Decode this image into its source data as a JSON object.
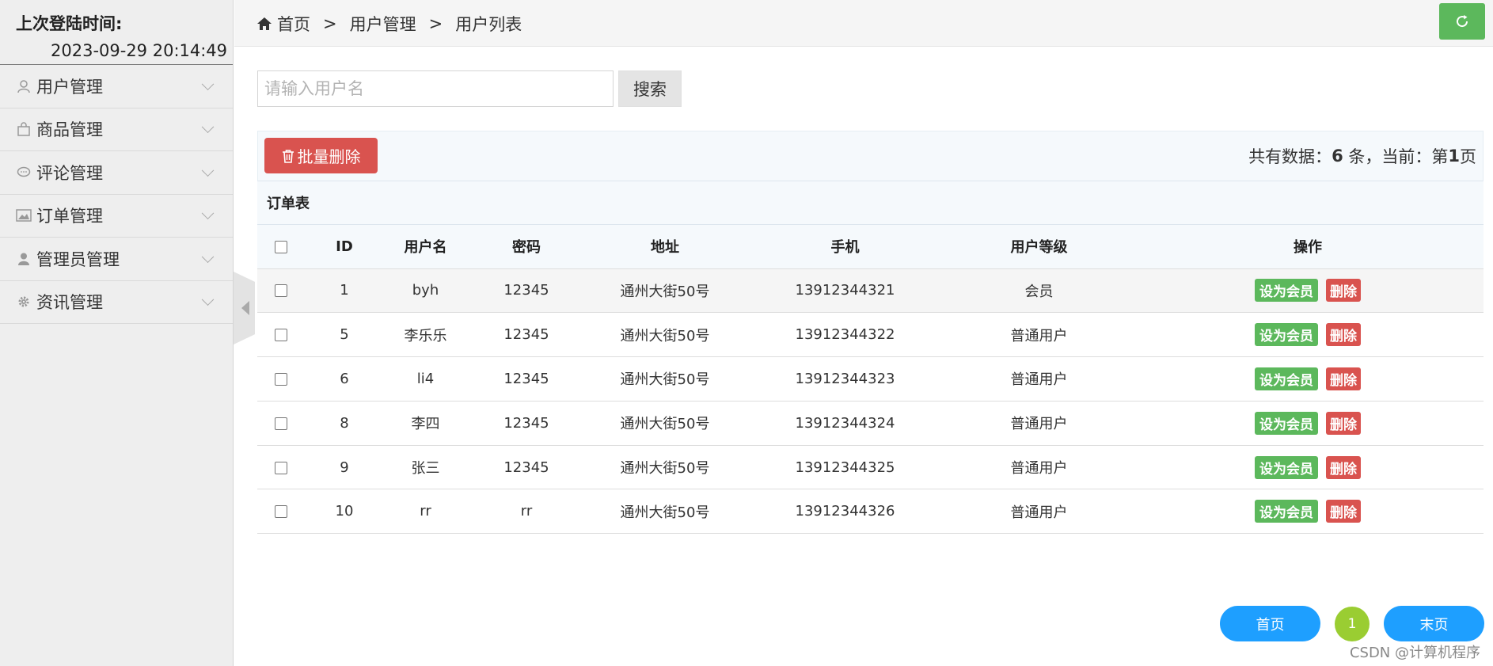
{
  "sidebar": {
    "login_title": "上次登陆时间:",
    "login_time": "2023-09-29 20:14:49",
    "items": [
      {
        "label": "用户管理",
        "icon": "user-icon"
      },
      {
        "label": "商品管理",
        "icon": "shopping-bag-icon"
      },
      {
        "label": "评论管理",
        "icon": "comment-icon"
      },
      {
        "label": "订单管理",
        "icon": "image-icon"
      },
      {
        "label": "管理员管理",
        "icon": "admin-icon"
      },
      {
        "label": "资讯管理",
        "icon": "gear-icon"
      }
    ]
  },
  "breadcrumb": {
    "home": "首页",
    "sep": ">",
    "level2": "用户管理",
    "level3": "用户列表"
  },
  "search": {
    "placeholder": "请输入用户名",
    "button": "搜索"
  },
  "toolbar": {
    "batch_delete": "批量删除",
    "stats_prefix": "共有数据：",
    "count": "6",
    "stats_mid": " 条，当前：第",
    "page": "1",
    "stats_suffix": "页"
  },
  "table": {
    "caption": "订单表",
    "headers": [
      "ID",
      "用户名",
      "密码",
      "地址",
      "手机",
      "用户等级",
      "操作"
    ],
    "rows": [
      {
        "id": "1",
        "username": "byh",
        "password": "12345",
        "address": "通州大街50号",
        "phone": "13912344321",
        "level": "会员"
      },
      {
        "id": "5",
        "username": "李乐乐",
        "password": "12345",
        "address": "通州大街50号",
        "phone": "13912344322",
        "level": "普通用户"
      },
      {
        "id": "6",
        "username": "li4",
        "password": "12345",
        "address": "通州大街50号",
        "phone": "13912344323",
        "level": "普通用户"
      },
      {
        "id": "8",
        "username": "李四",
        "password": "12345",
        "address": "通州大街50号",
        "phone": "13912344324",
        "level": "普通用户"
      },
      {
        "id": "9",
        "username": "张三",
        "password": "12345",
        "address": "通州大街50号",
        "phone": "13912344325",
        "level": "普通用户"
      },
      {
        "id": "10",
        "username": "rr",
        "password": "rr",
        "address": "通州大街50号",
        "phone": "13912344326",
        "level": "普通用户"
      }
    ],
    "action_member": "设为会员",
    "action_delete": "删除"
  },
  "pagination": {
    "first": "首页",
    "current": "1",
    "last": "末页"
  },
  "watermark": "CSDN @计算机程序",
  "colors": {
    "green": "#5cb85c",
    "red": "#d9534f",
    "blue": "#1e9fff",
    "lime": "#9acd32"
  }
}
